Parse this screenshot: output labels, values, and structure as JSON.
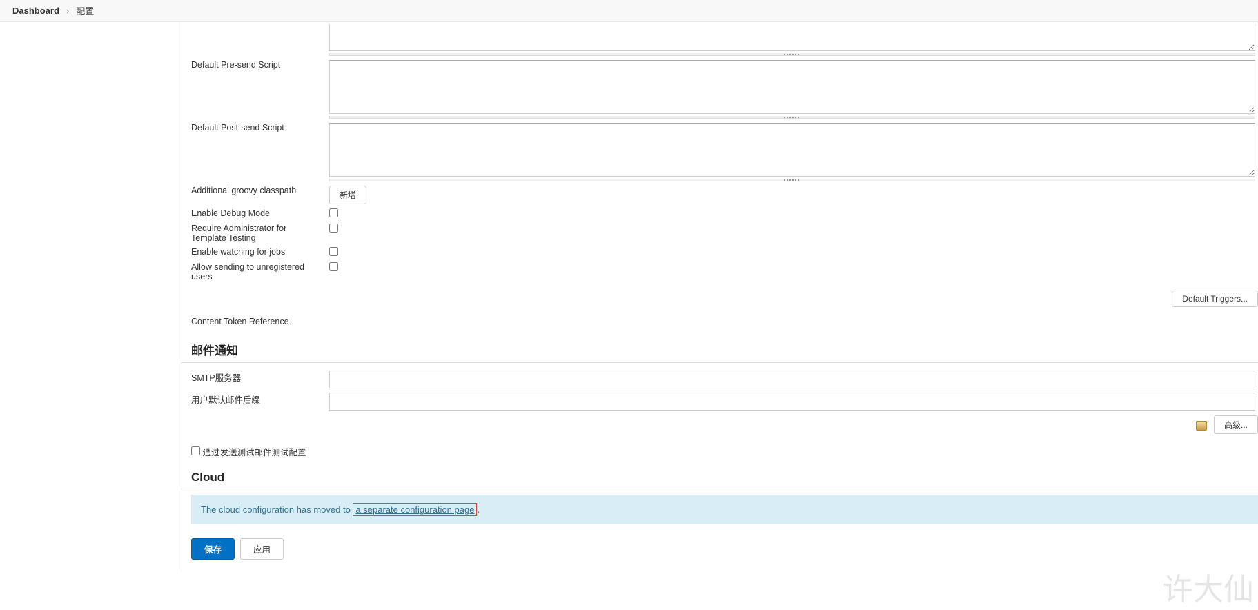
{
  "breadcrumb": {
    "root": "Dashboard",
    "current": "配置"
  },
  "form": {
    "defaultPreSend": {
      "label": "Default Pre-send Script",
      "value": ""
    },
    "defaultPostSend": {
      "label": "Default Post-send Script",
      "value": ""
    },
    "groovyClasspath": {
      "label": "Additional groovy classpath",
      "button": "新增"
    },
    "debugMode": {
      "label": "Enable Debug Mode"
    },
    "requireAdmin": {
      "label": "Require Administrator for Template Testing"
    },
    "watchJobs": {
      "label": "Enable watching for jobs"
    },
    "allowUnreg": {
      "label": "Allow sending to unregistered users"
    },
    "defaultTriggers": {
      "button": "Default Triggers..."
    },
    "contentToken": {
      "label": "Content Token Reference"
    }
  },
  "mail": {
    "title": "邮件通知",
    "smtp": {
      "label": "SMTP服务器",
      "value": ""
    },
    "suffix": {
      "label": "用户默认邮件后缀",
      "value": ""
    },
    "advanced": {
      "label": "高级..."
    },
    "testSend": {
      "label": "通过发送测试邮件测试配置"
    }
  },
  "cloud": {
    "title": "Cloud",
    "msgPrefix": "The cloud configuration has moved to ",
    "link": "a separate configuration page",
    "msgSuffix": "."
  },
  "actions": {
    "save": "保存",
    "apply": "应用"
  },
  "watermark": "许大仙"
}
